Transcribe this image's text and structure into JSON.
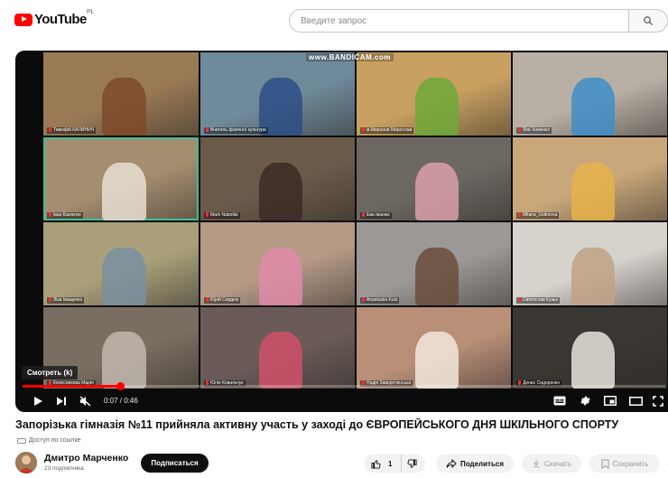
{
  "brand": {
    "name": "YouTube",
    "country": "PL",
    "accent": "#ff0000"
  },
  "search": {
    "placeholder": "Введите запрос",
    "icon": "search-icon"
  },
  "player": {
    "watermark": "www.BANDICAM.com",
    "seek_tooltip": "Смотреть (k)",
    "time": "0:07 / 0:46",
    "progress": 0.152,
    "tiles": [
      {
        "name": "Тимофій КАЛИНИЧ",
        "bg": "#9a7a55",
        "fg": "#7d4a2a"
      },
      {
        "name": "Вчитель фізичної культури",
        "bg": "#6f8a9a",
        "fg": "#2d4e86"
      },
      {
        "name": "м.Миронов Мирослав",
        "bg": "#c8a060",
        "fg": "#6fa83a"
      },
      {
        "name": "Лев Хоменко",
        "bg": "#b9b0a5",
        "fg": "#3e8ec8"
      },
      {
        "name": "Іван Басюгин",
        "bg": "#a58d70",
        "fg": "#e6dfd2"
      },
      {
        "name": "Mark Nabollal",
        "bg": "#6b5a4a",
        "fg": "#3a2c24"
      },
      {
        "name": "Ева Іванюк",
        "bg": "#6c6761",
        "fg": "#d9a0a8"
      },
      {
        "name": "Milana_Ustimova",
        "bg": "#c9a77a",
        "fg": "#e6b34a"
      },
      {
        "name": "Ліза Іващенко",
        "bg": "#a9a07a",
        "fg": "#7b8fa0"
      },
      {
        "name": "Юрій Сердюк",
        "bg": "#b59a86",
        "fg": "#e08ba8"
      },
      {
        "name": "Anastasiia Kuts",
        "bg": "#9c9895",
        "fg": "#6a4c3c"
      },
      {
        "name": "Святослав Кузьо",
        "bg": "#d6d2cc",
        "fg": "#bfa285"
      },
      {
        "name": "Колесникова Марія",
        "bg": "#7a6e62",
        "fg": "#c2b8ae"
      },
      {
        "name": "Юлія Ковальчук",
        "bg": "#6a5b58",
        "fg": "#d0506a"
      },
      {
        "name": "Надія Заворотинська",
        "bg": "#b98f78",
        "fg": "#f2e7dd"
      },
      {
        "name": "Денис Сидоренко",
        "bg": "#3a3632",
        "fg": "#e8e4dd"
      }
    ]
  },
  "video": {
    "title": "Запорізька гімназія №11 прийняла активну участь у заході до ЄВРОПЕЙСЬКОГО ДНЯ ШКІЛЬНОГО СПОРТУ",
    "access": "Доступ по ссылке"
  },
  "channel": {
    "name": "Дмитро Марченко",
    "subscribers": "23 подписчика",
    "subscribe_label": "Подписаться"
  },
  "actions": {
    "likes": "1",
    "share": "Поделиться",
    "download": "Скачать",
    "save": "Сохранить"
  }
}
